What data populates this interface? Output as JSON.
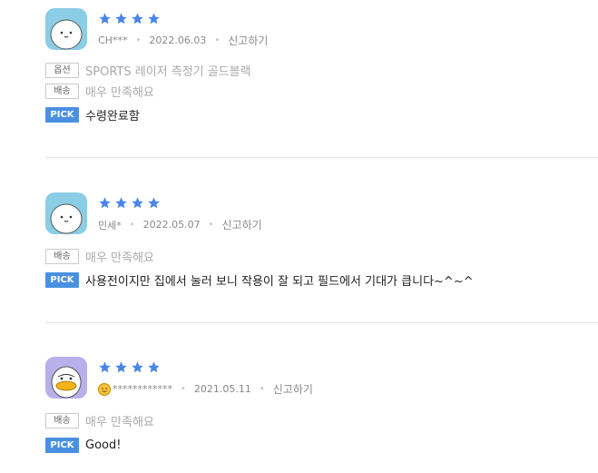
{
  "reviews": [
    {
      "rating": 4,
      "user": "CH***",
      "date": "2022.06.03",
      "report": "신고하기",
      "option_label": "옵션",
      "option_value": "SPORTS 레이저 측정기 골드블랙",
      "delivery_label": "배송",
      "delivery_value": "매우 만족해요",
      "pick_label": "PICK",
      "comment": "수령완료함",
      "avatar": "white-character-avatar"
    },
    {
      "rating": 4,
      "user": "민세*",
      "date": "2022.05.07",
      "report": "신고하기",
      "delivery_label": "배송",
      "delivery_value": "매우 만족해요",
      "pick_label": "PICK",
      "comment": "사용전이지만 집에서 눌러 보니 작용이 잘 되고 필드에서 기대가 큽니다~^~^",
      "avatar": "white-character-avatar"
    },
    {
      "rating": 4,
      "user": "************",
      "date": "2021.05.11",
      "report": "신고하기",
      "delivery_label": "배송",
      "delivery_value": "매우 만족해요",
      "pick_label": "PICK",
      "comment": "Good!",
      "avatar": "duck-character-avatar",
      "user_icon": "smiley-emoji-icon"
    }
  ],
  "colors": {
    "star": "#4a86e8",
    "pick": "#4a90e2",
    "divider": "#e6e6e6"
  }
}
